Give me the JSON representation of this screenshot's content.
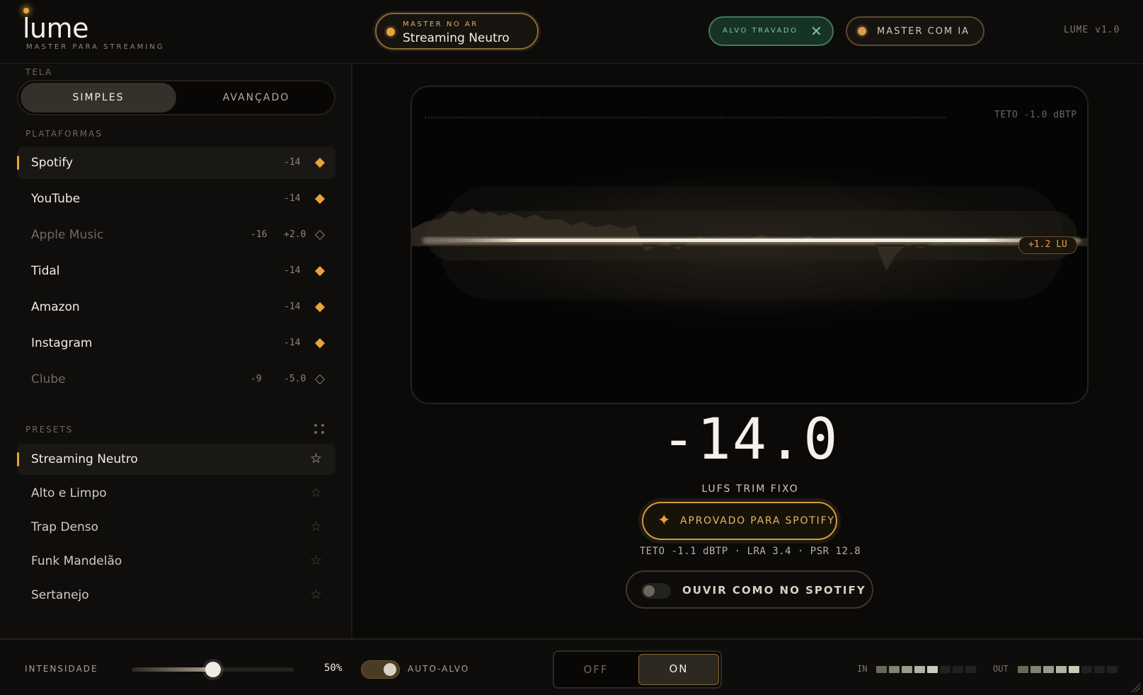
{
  "header": {
    "logo": "lume",
    "logo_sub": "MASTER PARA STREAMING",
    "master_small": "MASTER NO AR",
    "master_big": "Streaming Neutro",
    "alvo_label": "ALVO TRAVADO",
    "alvo_close": "✕",
    "ia_label": "MASTER COM IA",
    "version": "LUME v1.0"
  },
  "sidebar": {
    "tela_label": "TELA",
    "view_options": [
      "SIMPLES",
      "AVANÇADO"
    ],
    "platforms_label": "PLATAFORMAS",
    "platforms": [
      {
        "name": "Spotify",
        "lufs": "-14",
        "gain": "",
        "ok": true,
        "active": true
      },
      {
        "name": "YouTube",
        "lufs": "-14",
        "gain": "",
        "ok": true,
        "active": false
      },
      {
        "name": "Apple Music",
        "lufs": "-16",
        "gain": "+2.0",
        "ok": false,
        "active": false
      },
      {
        "name": "Tidal",
        "lufs": "-14",
        "gain": "",
        "ok": true,
        "active": false
      },
      {
        "name": "Amazon",
        "lufs": "-14",
        "gain": "",
        "ok": true,
        "active": false
      },
      {
        "name": "Instagram",
        "lufs": "-14",
        "gain": "",
        "ok": true,
        "active": false
      },
      {
        "name": "Clube",
        "lufs": "-9",
        "gain": "-5.0",
        "ok": false,
        "active": false
      }
    ],
    "presets_label": "PRESETS",
    "presets": [
      {
        "name": "Streaming Neutro",
        "active": true
      },
      {
        "name": "Alto e Limpo",
        "active": false
      },
      {
        "name": "Trap Denso",
        "active": false
      },
      {
        "name": "Funk Mandelão",
        "active": false
      },
      {
        "name": "Sertanejo",
        "active": false
      }
    ]
  },
  "main": {
    "teto_label": "TETO -1.0 dBTP",
    "lu_badge": "+1.2 LU",
    "value": "-14.0",
    "value_label": "LUFS TRIM FIXO",
    "approved": "APROVADO PARA SPOTIFY",
    "stats": "TETO -1.1 dBTP · LRA 3.4 · PSR 12.8",
    "listen": "OUVIR COMO NO SPOTIFY"
  },
  "bottom": {
    "intensity_label": "INTENSIDADE",
    "intensity_value": "50%",
    "intensity": 0.5,
    "auto_label": "AUTO-ALVO",
    "off": "OFF",
    "on": "ON",
    "in_label": "IN",
    "out_label": "OUT",
    "in_level": 5,
    "out_level": 5,
    "meter_segments": 8
  },
  "colors": {
    "accent": "#e8a33a",
    "success": "#7fc7a2",
    "background": "#0b0a09"
  }
}
